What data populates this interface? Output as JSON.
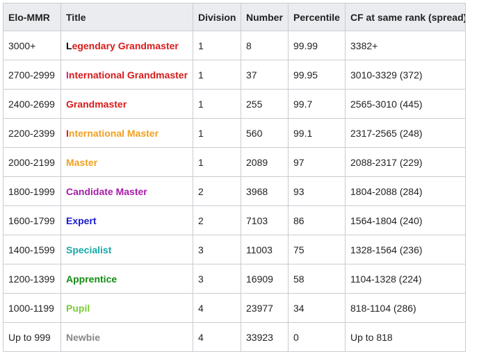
{
  "table": {
    "headers": [
      "Elo-MMR",
      "Title",
      "Division",
      "Number",
      "Percentile",
      "CF at same rank (spread)"
    ],
    "rows": [
      {
        "elo": "3000+",
        "title_first": "L",
        "title_rest": "egendary Grandmaster",
        "first_color": "#000000",
        "rest_color": "#d91a1a",
        "division": "1",
        "number": "8",
        "percentile": "99.99",
        "cf": "3382+"
      },
      {
        "elo": "2700-2999",
        "title_first": "I",
        "title_rest": "nternational Grandmaster",
        "first_color": "#e0169e",
        "rest_color": "#d91a1a",
        "division": "1",
        "number": "37",
        "percentile": "99.95",
        "cf": "3010-3329 (372)"
      },
      {
        "elo": "2400-2699",
        "title_first": "G",
        "title_rest": "randmaster",
        "first_color": "#d91a1a",
        "rest_color": "#d91a1a",
        "division": "1",
        "number": "255",
        "percentile": "99.7",
        "cf": "2565-3010 (445)"
      },
      {
        "elo": "2200-2399",
        "title_first": "I",
        "title_rest": "nternational Master",
        "first_color": "#d91a1a",
        "rest_color": "#f0a020",
        "division": "1",
        "number": "560",
        "percentile": "99.1",
        "cf": "2317-2565 (248)"
      },
      {
        "elo": "2000-2199",
        "title_first": "M",
        "title_rest": "aster",
        "first_color": "#f0a020",
        "rest_color": "#f0a020",
        "division": "1",
        "number": "2089",
        "percentile": "97",
        "cf": "2088-2317 (229)"
      },
      {
        "elo": "1800-1999",
        "title_first": "C",
        "title_rest": "andidate Master",
        "first_color": "#a81aa8",
        "rest_color": "#a81aa8",
        "division": "2",
        "number": "3968",
        "percentile": "93",
        "cf": "1804-2088 (284)"
      },
      {
        "elo": "1600-1799",
        "title_first": "E",
        "title_rest": "xpert",
        "first_color": "#1a1acc",
        "rest_color": "#1a1acc",
        "division": "2",
        "number": "7103",
        "percentile": "86",
        "cf": "1564-1804 (240)"
      },
      {
        "elo": "1400-1599",
        "title_first": "S",
        "title_rest": "pecialist",
        "first_color": "#18a8a8",
        "rest_color": "#18a8a8",
        "division": "3",
        "number": "11003",
        "percentile": "75",
        "cf": "1328-1564 (236)"
      },
      {
        "elo": "1200-1399",
        "title_first": "A",
        "title_rest": "pprentice",
        "first_color": "#138a13",
        "rest_color": "#138a13",
        "division": "3",
        "number": "16909",
        "percentile": "58",
        "cf": "1104-1328 (224)"
      },
      {
        "elo": "1000-1199",
        "title_first": "P",
        "title_rest": "upil",
        "first_color": "#7ccc30",
        "rest_color": "#7ccc30",
        "division": "4",
        "number": "23977",
        "percentile": "34",
        "cf": "818-1104 (286)"
      },
      {
        "elo": "Up to 999",
        "title_first": "N",
        "title_rest": "ewbie",
        "first_color": "#888888",
        "rest_color": "#888888",
        "division": "4",
        "number": "33923",
        "percentile": "0",
        "cf": "Up to 818"
      }
    ]
  }
}
